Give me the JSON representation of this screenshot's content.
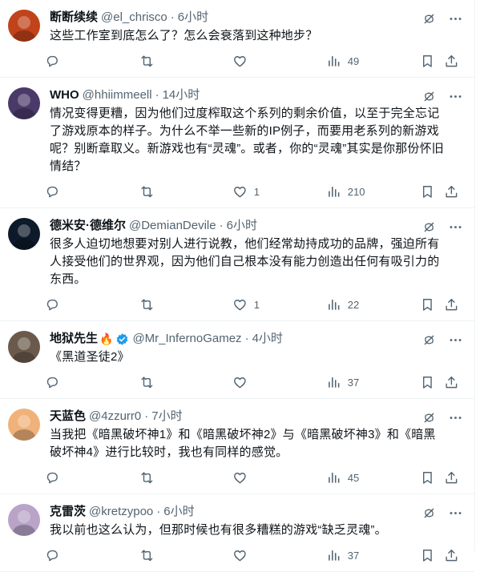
{
  "tweets": [
    {
      "name": "断断续续",
      "handle": "@el_chrisco",
      "time": "6小时",
      "text": "这些工作室到底怎么了？怎么会衰落到这种地步？",
      "likes": "",
      "views": "49",
      "avatar_color": "#c0431a"
    },
    {
      "name": "WHO",
      "handle": "@hhiimmeell",
      "time": "14小时",
      "text": "情况变得更糟，因为他们过度榨取这个系列的剩余价值，以至于完全忘记了游戏原本的样子。为什么不举一些新的IP例子，而要用老系列的新游戏呢？别断章取义。新游戏也有“灵魂”。或者，你的“灵魂”其实是你那份怀旧情结？",
      "likes": "1",
      "views": "210",
      "avatar_color": "#4a3a6a"
    },
    {
      "name": "德米安·德维尔",
      "handle": "@DemianDevile",
      "time": "6小时",
      "text": "很多人迫切地想要对别人进行说教，他们经常劫持成功的品牌，强迫所有人接受他们的世界观，因为他们自己根本没有能力创造出任何有吸引力的东西。",
      "likes": "1",
      "views": "22",
      "avatar_color": "#0c1a2a"
    },
    {
      "name": "地狱先生",
      "flame": "🔥",
      "verified": true,
      "handle": "@Mr_InfernoGamez",
      "time": "4小时",
      "text": "《黑道圣徒2》",
      "likes": "",
      "views": "37",
      "avatar_color": "#6b5a4c"
    },
    {
      "name": "天蓝色",
      "handle": "@4zzurr0",
      "time": "7小时",
      "text": "当我把《暗黑破坏神1》和《暗黑破坏神2》与《暗黑破坏神3》和《暗黑破坏神4》进行比较时，我也有同样的感觉。",
      "likes": "",
      "views": "45",
      "avatar_color": "#f0b27a"
    },
    {
      "name": "克雷茨",
      "handle": "@kretzypoo",
      "time": "6小时",
      "text": "我以前也这么认为，但那时候也有很多糟糕的游戏“缺乏灵魂”。",
      "likes": "",
      "views": "37",
      "avatar_color": "#b9a4c8"
    }
  ],
  "colors": {
    "secondary_text": "#536471",
    "verified": "#1d9bf0",
    "border": "#eff3f4"
  }
}
